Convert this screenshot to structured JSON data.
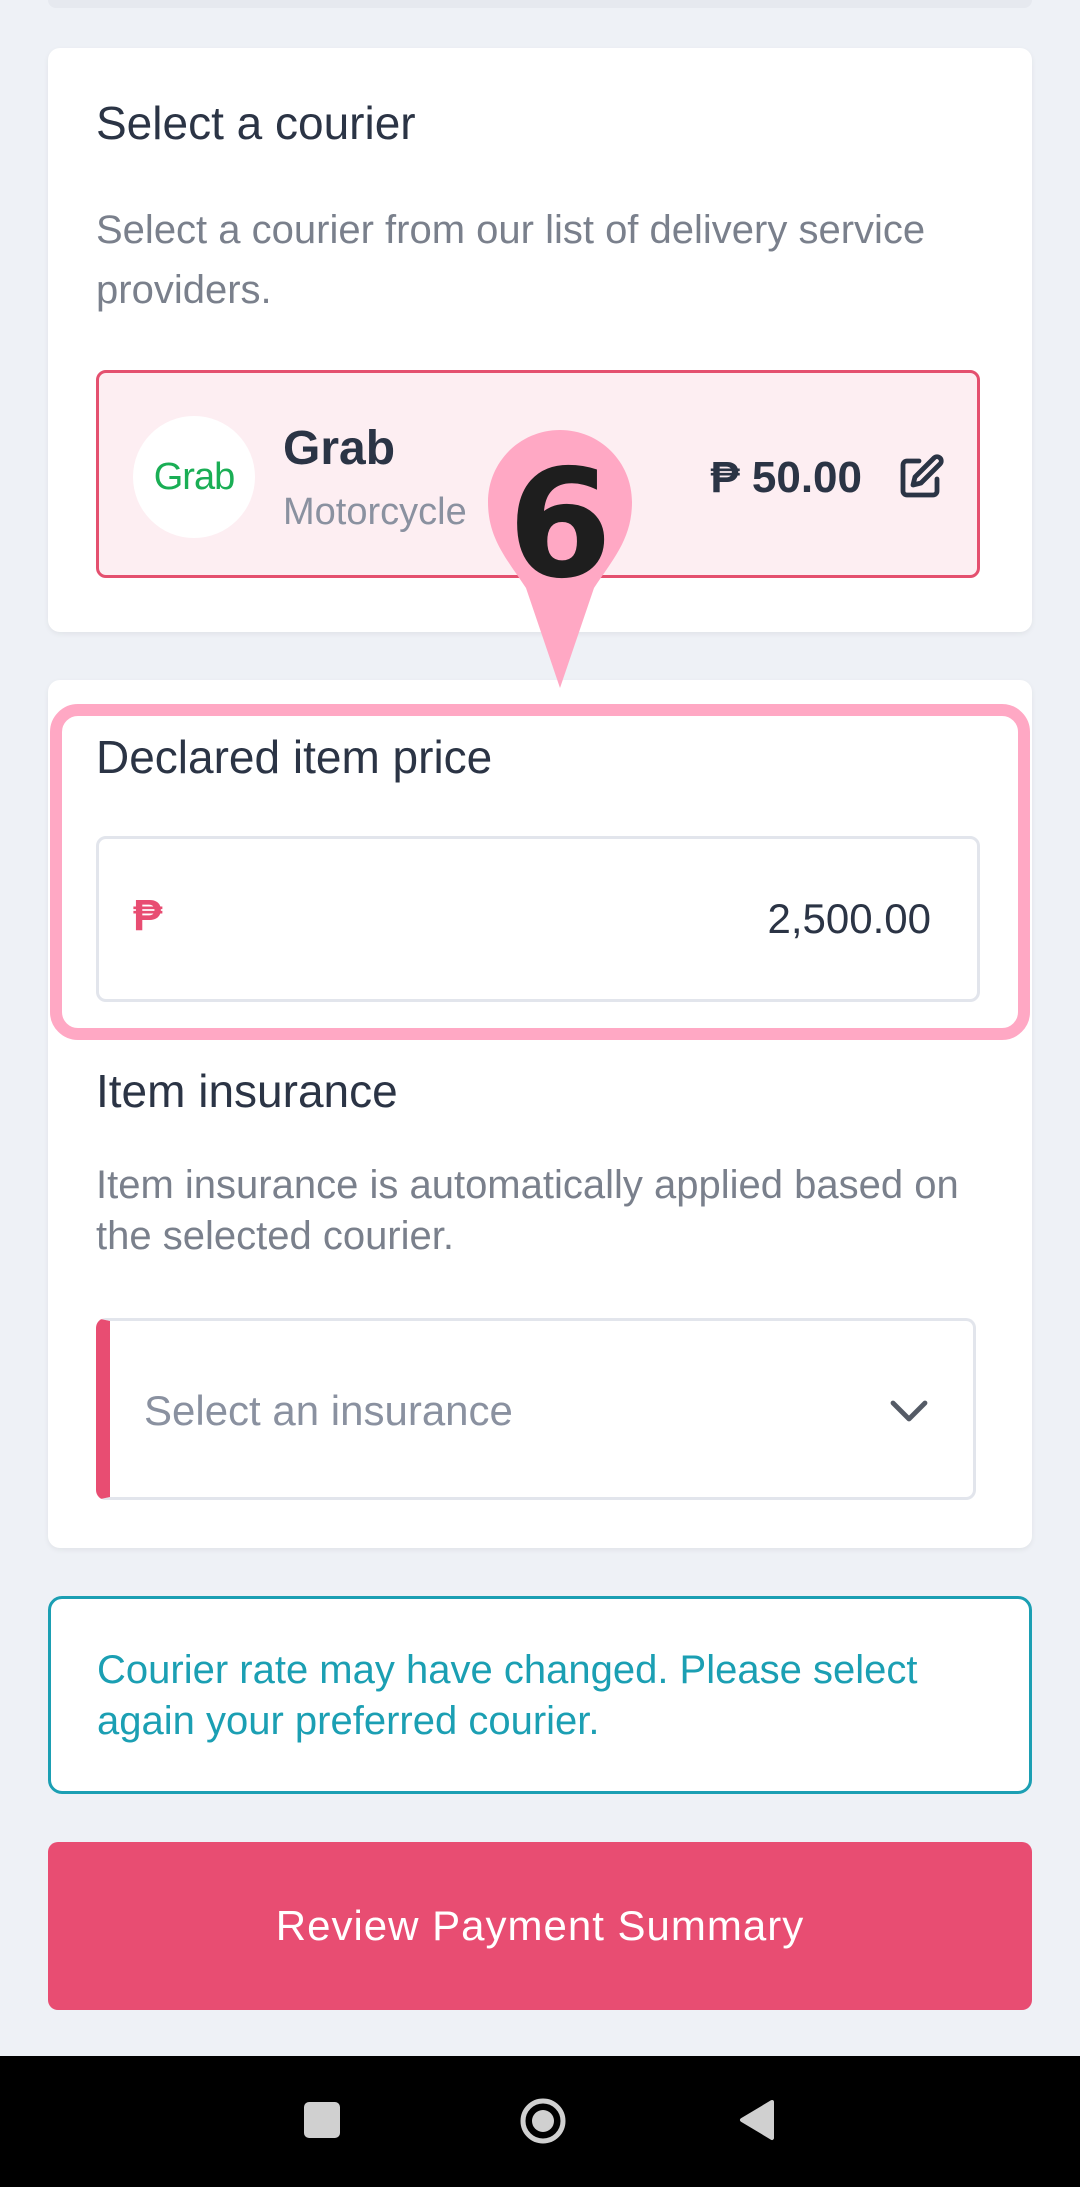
{
  "courier_section": {
    "title": "Select a courier",
    "description": "Select a courier from our list of delivery service providers.",
    "selected": {
      "logo_text": "Grab",
      "name": "Grab",
      "vehicle": "Motorcycle",
      "price": "₱ 50.00",
      "edit_icon": "edit-icon"
    }
  },
  "declared_price": {
    "title": "Declared item price",
    "currency_symbol": "₱",
    "value": "2,500.00"
  },
  "insurance": {
    "title": "Item insurance",
    "description": "Item insurance is automatically applied based on the selected courier.",
    "placeholder": "Select an insurance",
    "icon": "chevron-down-icon"
  },
  "notice": {
    "text": "Courier rate may have changed. Please select again your preferred courier."
  },
  "actions": {
    "review_label": "Review Payment Summary"
  },
  "tutorial": {
    "step": "6"
  },
  "colors": {
    "accent": "#e84d72",
    "info": "#1b9fb3",
    "highlight": "#ffa8c4",
    "grab_green": "#1aae55"
  },
  "system_nav": {
    "icons": [
      "recents-square-icon",
      "home-circle-icon",
      "back-triangle-icon"
    ]
  }
}
